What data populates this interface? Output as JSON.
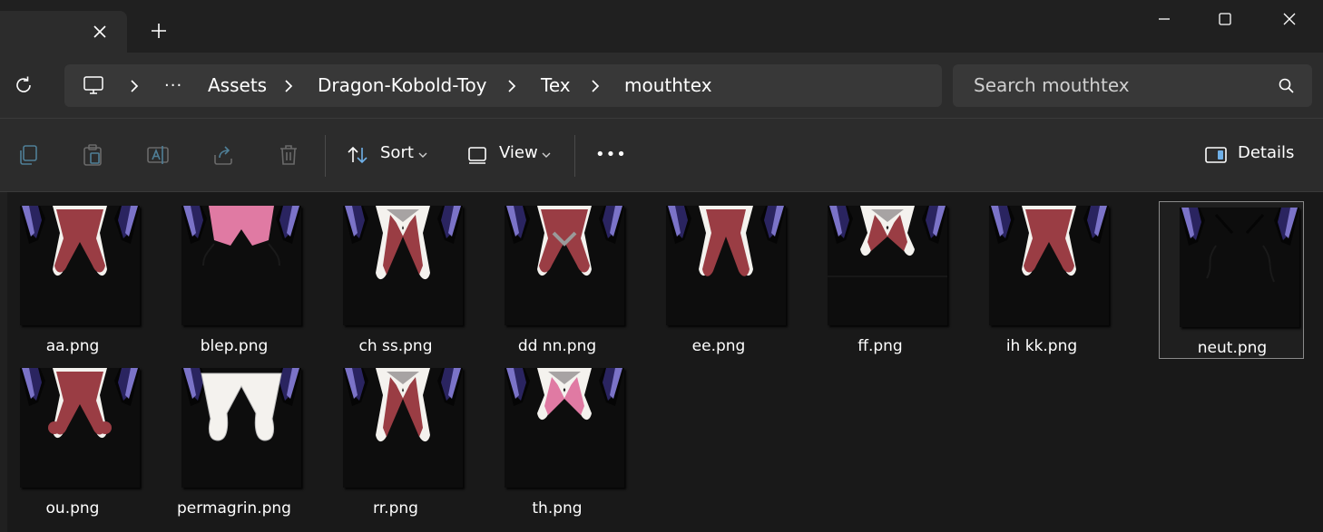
{
  "window": {
    "tab_close_icon": "close-icon",
    "new_tab_icon": "plus-icon"
  },
  "address": {
    "crumbs": [
      "Assets",
      "Dragon-Kobold-Toy",
      "Tex",
      "mouthtex"
    ],
    "overflow_label": "···",
    "root_icon": "monitor-icon"
  },
  "search": {
    "placeholder": "Search mouthtex"
  },
  "toolbar": {
    "sort_label": "Sort",
    "view_label": "View",
    "more_label": "•••",
    "details_label": "Details"
  },
  "files": [
    {
      "name": "aa.png",
      "style": "open-red"
    },
    {
      "name": "blep.png",
      "style": "blep"
    },
    {
      "name": "ch ss.png",
      "style": "narrow-red"
    },
    {
      "name": "dd nn.png",
      "style": "dd-red"
    },
    {
      "name": "ee.png",
      "style": "wide-red"
    },
    {
      "name": "ff.png",
      "style": "ff-red"
    },
    {
      "name": "ih kk.png",
      "style": "open-red-slim"
    },
    {
      "name": "neut.png",
      "style": "neutral",
      "selected": true
    },
    {
      "name": "ou.png",
      "style": "ou-red"
    },
    {
      "name": "permagrin.png",
      "style": "white"
    },
    {
      "name": "rr.png",
      "style": "narrow-red"
    },
    {
      "name": "th.png",
      "style": "th-pink"
    }
  ],
  "colors": {
    "mouth_red": "#9a3d44",
    "tongue_pink": "#e07aa3",
    "fang_purple": "#2a2460",
    "fang_blue": "#7b73c8"
  }
}
